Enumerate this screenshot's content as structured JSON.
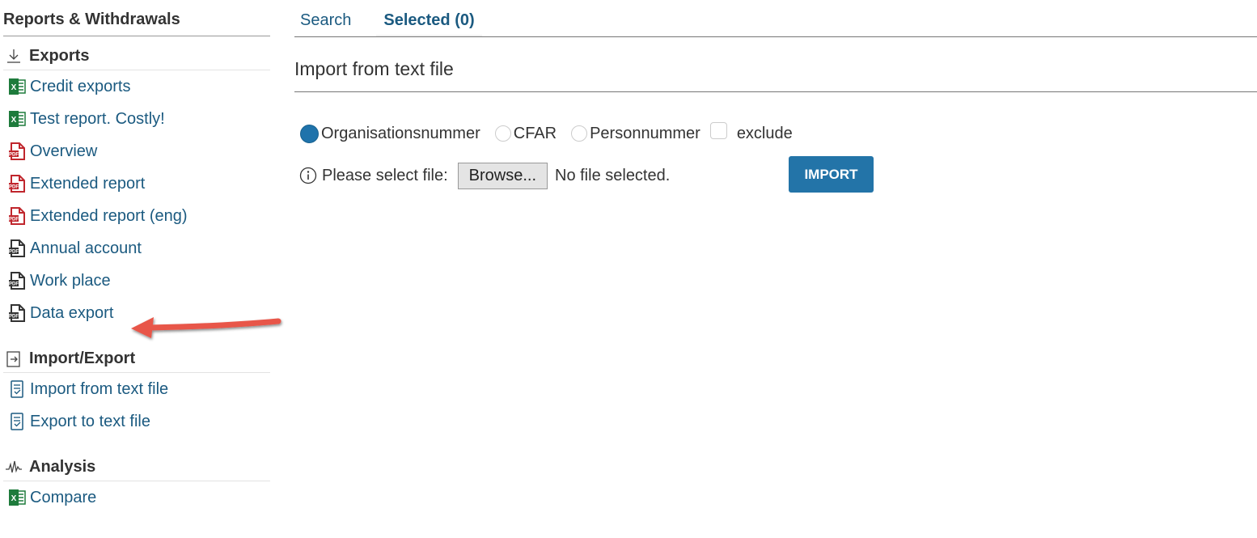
{
  "sidebar": {
    "title": "Reports & Withdrawals",
    "sections": [
      {
        "heading": "Exports",
        "icon": "download-icon",
        "items": [
          {
            "label": "Credit exports",
            "icon": "excel-icon"
          },
          {
            "label": "Test report. Costly!",
            "icon": "excel-icon"
          },
          {
            "label": "Overview",
            "icon": "pdf-icon"
          },
          {
            "label": "Extended report",
            "icon": "pdf-icon"
          },
          {
            "label": "Extended report (eng)",
            "icon": "pdf-icon"
          },
          {
            "label": "Annual account",
            "icon": "pdf-dark-icon"
          },
          {
            "label": "Work place",
            "icon": "pdf-dark-icon"
          },
          {
            "label": "Data export",
            "icon": "pdf-dark-icon"
          }
        ]
      },
      {
        "heading": "Import/Export",
        "icon": "import-export-icon",
        "items": [
          {
            "label": "Import from text file",
            "icon": "text-file-icon"
          },
          {
            "label": "Export to text file",
            "icon": "text-file-icon"
          }
        ]
      },
      {
        "heading": "Analysis",
        "icon": "pulse-icon",
        "items": [
          {
            "label": "Compare",
            "icon": "excel-icon"
          }
        ]
      }
    ]
  },
  "tabs": [
    {
      "label": "Search",
      "active": false
    },
    {
      "label": "Selected (0)",
      "active": true
    }
  ],
  "page": {
    "title": "Import from text file",
    "options": {
      "radio_1": "Organisationsnummer",
      "radio_2": "CFAR",
      "radio_3": "Personnummer",
      "checkbox": "exclude",
      "selected": "Organisationsnummer"
    },
    "file": {
      "label": "Please select file:",
      "browse_label": "Browse...",
      "status": "No file selected."
    },
    "import_label": "IMPORT"
  },
  "colors": {
    "link": "#1b5a80",
    "primary_button": "#2374a8",
    "annotation_arrow": "#e8574a",
    "excel_green": "#1e7b3c",
    "pdf_red": "#c0262d"
  }
}
